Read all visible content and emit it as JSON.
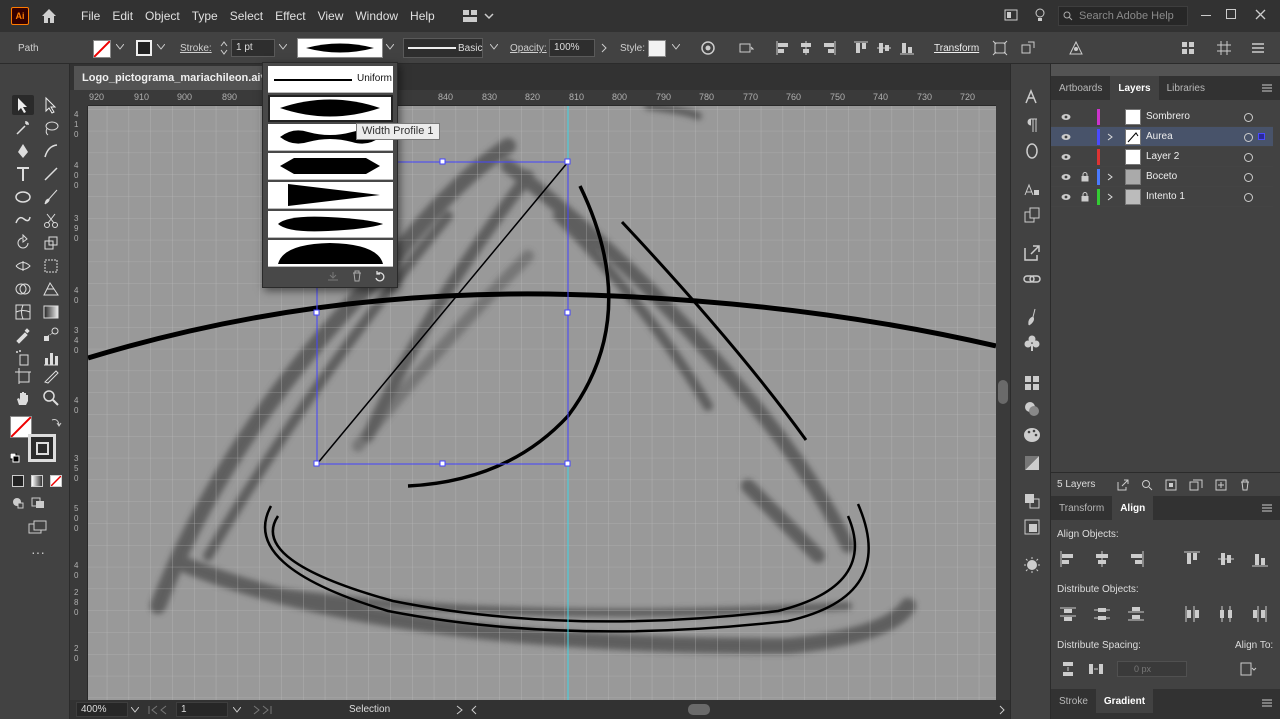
{
  "menubar": {
    "app_icon": "Ai",
    "items": [
      "File",
      "Edit",
      "Object",
      "Type",
      "Select",
      "Effect",
      "View",
      "Window",
      "Help"
    ],
    "search_placeholder": "Search Adobe Help"
  },
  "control_bar": {
    "selection_label": "Path",
    "stroke_label": "Stroke:",
    "stroke_weight": "1 pt",
    "brush_label": "Basic",
    "opacity_label": "Opacity:",
    "opacity_value": "100%",
    "style_label": "Style:",
    "transform_label": "Transform"
  },
  "document": {
    "tab_title": "Logo_pictograma_mariachileon.ai* @"
  },
  "rulers": {
    "top": [
      "920",
      "910",
      "900",
      "890",
      "840",
      "830",
      "820",
      "810",
      "800",
      "790",
      "780",
      "770",
      "760",
      "750",
      "740",
      "730",
      "720"
    ],
    "left_digits": [
      "4",
      "1",
      "0",
      "4",
      "0",
      "0",
      "3",
      "9",
      "0",
      "4",
      "0",
      "3",
      "4",
      "0",
      "4",
      "0",
      "3",
      "5",
      "0",
      "5",
      "0",
      "0",
      "4",
      "0",
      "2",
      "8",
      "0",
      "2",
      "0"
    ]
  },
  "width_profile_menu": {
    "uniform_label": "Uniform",
    "tooltip": "Width Profile 1"
  },
  "status_bar": {
    "zoom": "400%",
    "artboard": "1",
    "tool": "Selection"
  },
  "layers_panel": {
    "tabs": [
      "Artboards",
      "Layers",
      "Libraries"
    ],
    "active_tab": "Layers",
    "layers": [
      {
        "name": "Sombrero",
        "color": "#cc33cc",
        "locked": false,
        "expandable": false,
        "selected": false
      },
      {
        "name": "Aurea",
        "color": "#4a4aff",
        "locked": false,
        "expandable": true,
        "selected": true
      },
      {
        "name": "Layer 2",
        "color": "#dd3333",
        "locked": false,
        "expandable": false,
        "selected": false
      },
      {
        "name": "Boceto",
        "color": "#4a7aff",
        "locked": true,
        "expandable": true,
        "selected": false
      },
      {
        "name": "Intento 1",
        "color": "#33cc33",
        "locked": true,
        "expandable": true,
        "selected": false
      }
    ],
    "count": "5 Layers"
  },
  "align_panel": {
    "tabs": [
      "Transform",
      "Align"
    ],
    "active_tab": "Align",
    "align_objects": "Align Objects:",
    "distribute_objects": "Distribute Objects:",
    "distribute_spacing": "Distribute Spacing:",
    "align_to": "Align To:",
    "spacing_value": "0 px"
  },
  "bottom_tabs": [
    "Stroke",
    "Gradient"
  ],
  "bottom_active": "Gradient",
  "colors": {
    "selection_blue": "#4444ff",
    "guide_cyan": "#3dd6e6",
    "accent_orange": "#ff7c00"
  }
}
